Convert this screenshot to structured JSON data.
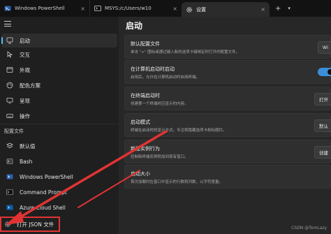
{
  "tabs": [
    {
      "label": "Windows PowerShell",
      "icon": "powershell-icon"
    },
    {
      "label": "MSYS:/c/Users/w10",
      "icon": "terminal-icon"
    },
    {
      "label": "设置",
      "icon": "gear-icon"
    }
  ],
  "tab_close": "×",
  "tab_new": "+",
  "tab_dropdown": "▾",
  "sidebar": {
    "items": [
      {
        "label": "启动",
        "icon": "startup-icon"
      },
      {
        "label": "交互",
        "icon": "interaction-icon"
      },
      {
        "label": "外观",
        "icon": "appearance-icon"
      },
      {
        "label": "配色方案",
        "icon": "palette-icon"
      },
      {
        "label": "呈现",
        "icon": "monitor-icon"
      },
      {
        "label": "操作",
        "icon": "keyboard-icon"
      }
    ],
    "profiles_label": "配置文件",
    "profiles": [
      {
        "label": "默认值",
        "icon": "layers-icon"
      },
      {
        "label": "Bash",
        "icon": "bash-icon"
      },
      {
        "label": "Windows PowerShell",
        "icon": "powershell-icon"
      },
      {
        "label": "Command Prompt",
        "icon": "cmd-icon"
      },
      {
        "label": "Azure Cloud Shell",
        "icon": "azure-icon"
      }
    ],
    "open_json": "打开 JSON 文件"
  },
  "main": {
    "title": "启动",
    "cards": [
      {
        "title": "默认配置文件",
        "desc": "单击 \"+\" 图标或通过键入新的选项卡键绑定时打开的配置文件。",
        "control": "Wi"
      },
      {
        "title": "在计算机启动时启动",
        "desc": "启用后，允许在计算机启动时启用终端。",
        "control": ""
      },
      {
        "title": "在终端启动时",
        "desc": "创建第一个终端时应显示的内容。",
        "control": "打开"
      },
      {
        "title": "启动模式",
        "desc": "终端在启动时的显示方式。专注将隐藏选项卡和标题栏。",
        "control": "默认"
      },
      {
        "title": "新建实例行为",
        "desc": "控制新终端实例附加到现有窗口。",
        "control": "创建"
      },
      {
        "title": "启动大小",
        "desc": "首次加载时在窗口中显示的行数和列数，以字符度量。",
        "control": ""
      }
    ]
  },
  "watermark": "CSDN @TomLazy",
  "colors": {
    "accent": "#4fc3f7",
    "toggle_on": "#3b8fd8",
    "annotation": "#e23333"
  }
}
